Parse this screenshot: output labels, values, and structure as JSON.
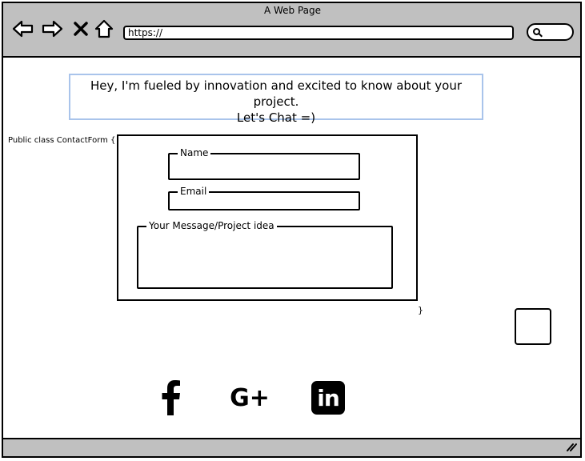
{
  "window": {
    "title": "A Web Page",
    "url": "https://"
  },
  "toolbar": {
    "back_icon": "back-arrow-icon",
    "forward_icon": "forward-arrow-icon",
    "stop_icon": "close-icon",
    "home_icon": "home-icon",
    "search_icon": "search-icon"
  },
  "hero": {
    "line1": "Hey, I'm fueled by innovation and excited to know about your project.",
    "line2": "Let's Chat =)"
  },
  "code": {
    "open": "Public class ContactForm {",
    "close": "}"
  },
  "form": {
    "name_label": "Name",
    "name_value": "",
    "email_label": "Email",
    "email_value": "",
    "message_label": "Your Message/Project idea",
    "message_value": ""
  },
  "social": {
    "facebook_icon": "facebook-icon",
    "google_plus_label": "G+",
    "linkedin_label": "in"
  }
}
